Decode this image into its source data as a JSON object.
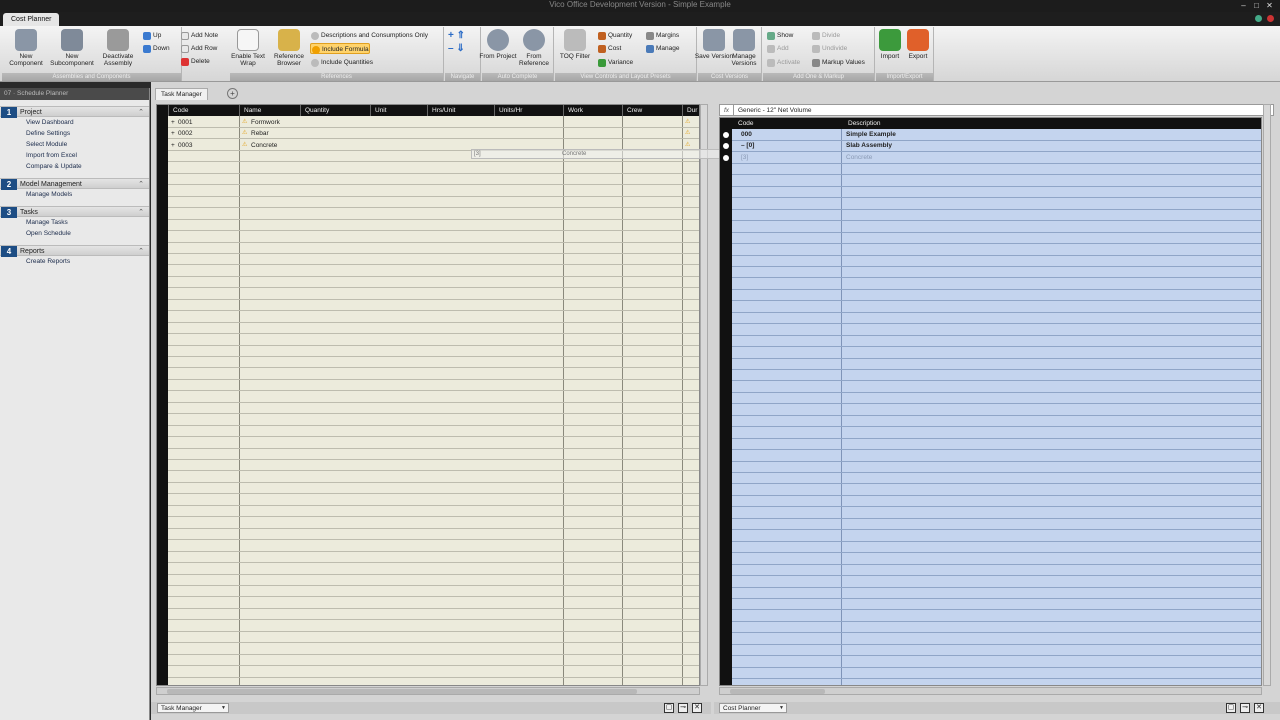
{
  "window": {
    "title": "Vico Office Development Version - Simple Example"
  },
  "app_tab": "Cost Planner",
  "ribbon": {
    "groups": [
      {
        "label": "Assemblies and Components"
      },
      {
        "label": "References"
      },
      {
        "label": "Navigate"
      },
      {
        "label": "Auto Complete"
      },
      {
        "label": "View Controls and Layout Presets"
      },
      {
        "label": "Cost Versions"
      },
      {
        "label": "Add One & Markup"
      },
      {
        "label": "Import/Export"
      }
    ],
    "new_component": "New Component",
    "new_subcomponent": "New Subcomponent",
    "deactivate_assembly": "Deactivate Assembly",
    "up": "Up",
    "down": "Down",
    "add_note": "Add Note",
    "add_row": "Add Row",
    "delete": "Delete",
    "enable_text_wrap": "Enable Text Wrap",
    "reference_browser": "Reference Browser",
    "descriptions_only": "Descriptions and Consumptions Only",
    "include_formula": "Include Formula",
    "include_quantities": "Include Quantities",
    "from_project": "From Project",
    "from_reference": "From Reference",
    "toq_filter": "TOQ Filter",
    "quantity": "Quantity",
    "cost": "Cost",
    "variance": "Variance",
    "margins": "Margins",
    "manage": "Manage",
    "save_version": "Save Version",
    "manage_versions": "Manage Versions",
    "show": "Show",
    "add": "Add",
    "activate": "Activate",
    "divide": "Divide",
    "undivide": "Undivide",
    "markup_values": "Markup Values",
    "import": "Import",
    "export": "Export"
  },
  "sidebar": {
    "header": "07 · Schedule Planner",
    "sections": [
      {
        "num": "1",
        "title": "Project",
        "items": [
          "View Dashboard",
          "Define Settings",
          "Select Module",
          "Import from Excel",
          "Compare & Update"
        ]
      },
      {
        "num": "2",
        "title": "Model Management",
        "items": [
          "Manage Models"
        ]
      },
      {
        "num": "3",
        "title": "Tasks",
        "items": [
          "Manage Tasks",
          "Open Schedule"
        ]
      },
      {
        "num": "4",
        "title": "Reports",
        "items": [
          "Create Reports"
        ]
      }
    ]
  },
  "left_panel": {
    "tab": "Task Manager",
    "columns": [
      "Code",
      "Name",
      "Quantity",
      "Unit",
      "Hrs/Unit",
      "Units/Hr",
      "Work",
      "Crew",
      "Dur"
    ],
    "rows": [
      {
        "code": "0001",
        "name": "Formwork"
      },
      {
        "code": "0002",
        "name": "Rebar"
      },
      {
        "code": "0003",
        "name": "Concrete"
      }
    ],
    "drag_ghost": {
      "left": "[3]",
      "right": "Concrete"
    },
    "footer_dropdown": "Task Manager"
  },
  "right_panel": {
    "formula_fx": "fx",
    "formula_value": "Generic - 12\" Net Volume",
    "columns": [
      "Code",
      "Description"
    ],
    "rows": [
      {
        "code": "000",
        "desc": "Simple Example"
      },
      {
        "code": "– [0]",
        "desc": "Slab Assembly"
      },
      {
        "code": "[3]",
        "desc": "Concrete"
      }
    ],
    "footer_dropdown": "Cost Planner"
  }
}
